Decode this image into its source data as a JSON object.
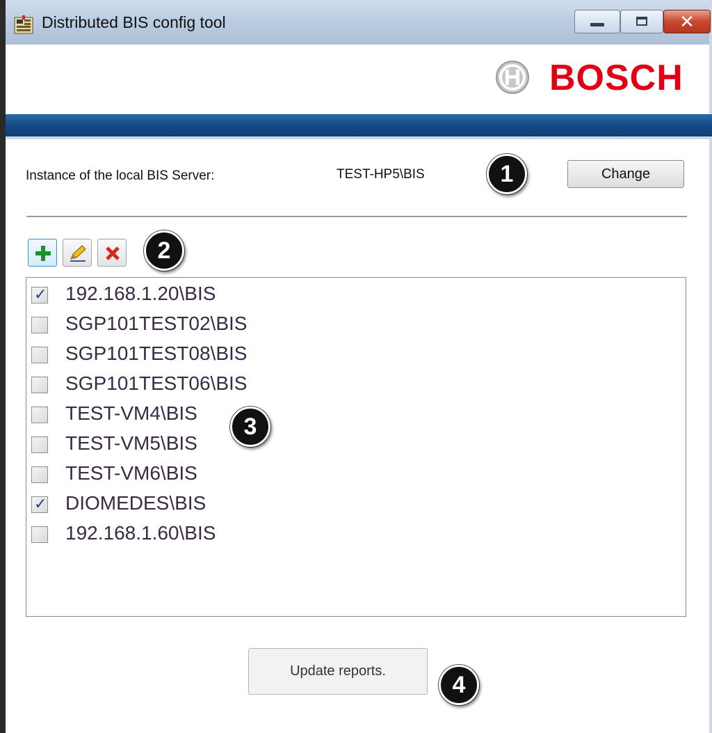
{
  "window": {
    "title": "Distributed BIS config tool"
  },
  "brand": {
    "name": "BOSCH",
    "color": "#e20015"
  },
  "instance": {
    "label": "Instance of the local BIS Server:",
    "value": "TEST-HP5\\BIS",
    "change_label": "Change"
  },
  "toolbar": {
    "add_icon": "add-icon",
    "edit_icon": "edit-icon",
    "delete_icon": "delete-icon"
  },
  "servers": [
    {
      "label": "192.168.1.20\\BIS",
      "checked": true
    },
    {
      "label": "SGP101TEST02\\BIS",
      "checked": false
    },
    {
      "label": "SGP101TEST08\\BIS",
      "checked": false
    },
    {
      "label": "SGP101TEST06\\BIS",
      "checked": false
    },
    {
      "label": "TEST-VM4\\BIS",
      "checked": false
    },
    {
      "label": "TEST-VM5\\BIS",
      "checked": false
    },
    {
      "label": "TEST-VM6\\BIS",
      "checked": false
    },
    {
      "label": "DIOMEDES\\BIS",
      "checked": true
    },
    {
      "label": "192.168.1.60\\BIS",
      "checked": false
    }
  ],
  "update_label": "Update reports.",
  "callouts": [
    "1",
    "2",
    "3",
    "4"
  ]
}
